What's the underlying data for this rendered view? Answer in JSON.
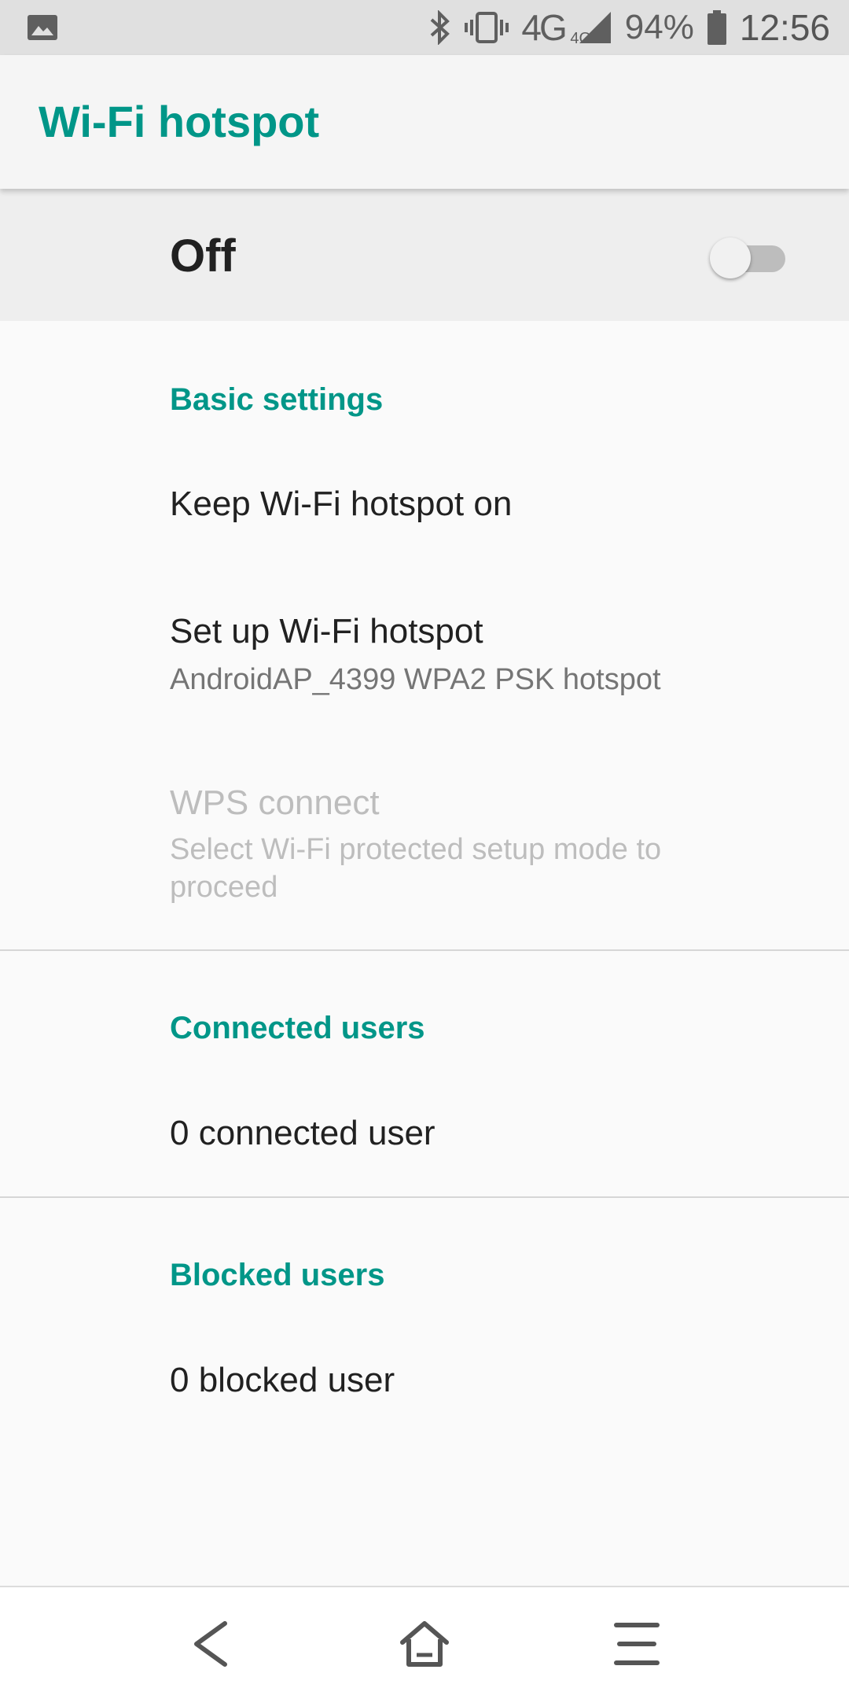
{
  "status_bar": {
    "notification_icon": "image-icon",
    "bluetooth_icon": "bluetooth-icon",
    "vibrate_icon": "vibrate-icon",
    "network": "4G",
    "network_small": "4G",
    "signal_icon": "signal-icon",
    "battery_percent": "94%",
    "battery_icon": "battery-icon",
    "time": "12:56"
  },
  "app_bar": {
    "title": "Wi-Fi hotspot"
  },
  "master_switch": {
    "label": "Off",
    "checked": false
  },
  "sections": {
    "basic": {
      "header": "Basic settings",
      "keep_on": {
        "title": "Keep Wi-Fi hotspot on"
      },
      "setup": {
        "title": "Set up Wi-Fi hotspot",
        "summary": "AndroidAP_4399 WPA2 PSK hotspot"
      },
      "wps": {
        "title": "WPS connect",
        "summary": "Select Wi-Fi protected setup mode to proceed",
        "enabled": false
      }
    },
    "connected": {
      "header": "Connected users",
      "count_text": "0 connected user"
    },
    "blocked": {
      "header": "Blocked users",
      "count_text": "0 blocked user"
    }
  },
  "nav_bar": {
    "back_icon": "back-icon",
    "home_icon": "home-icon",
    "menu_icon": "menu-icon"
  },
  "colors": {
    "accent": "#009688",
    "text_primary": "#212121",
    "text_secondary": "#757575",
    "text_disabled": "#bdbdbd"
  }
}
